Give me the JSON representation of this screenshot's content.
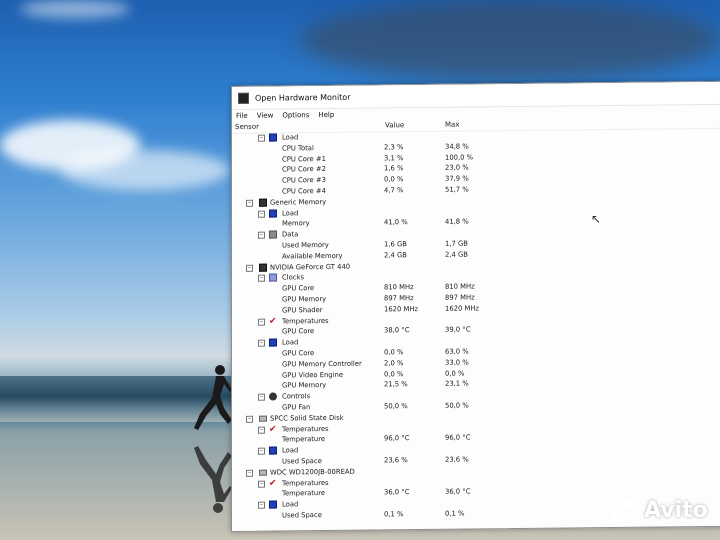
{
  "window": {
    "title": "Open Hardware Monitor",
    "menu": [
      "File",
      "View",
      "Options",
      "Help"
    ],
    "columns": {
      "sensor": "Sensor",
      "value": "Value",
      "max": "Max"
    }
  },
  "tree": [
    {
      "label": "Load",
      "value": "",
      "max": "",
      "indent": 1,
      "icon": "load-icon",
      "expander": "minus"
    },
    {
      "label": "CPU Total",
      "value": "2,3 %",
      "max": "34,8 %",
      "indent": 2,
      "icon": "",
      "expander": ""
    },
    {
      "label": "CPU Core #1",
      "value": "3,1 %",
      "max": "100,0 %",
      "indent": 2,
      "icon": "",
      "expander": ""
    },
    {
      "label": "CPU Core #2",
      "value": "1,6 %",
      "max": "23,0 %",
      "indent": 2,
      "icon": "",
      "expander": ""
    },
    {
      "label": "CPU Core #3",
      "value": "0,0 %",
      "max": "37,9 %",
      "indent": 2,
      "icon": "",
      "expander": ""
    },
    {
      "label": "CPU Core #4",
      "value": "4,7 %",
      "max": "51,7 %",
      "indent": 2,
      "icon": "",
      "expander": ""
    },
    {
      "label": "Generic Memory",
      "value": "",
      "max": "",
      "indent": 0,
      "icon": "memory-chip-icon",
      "expander": "minus"
    },
    {
      "label": "Load",
      "value": "",
      "max": "",
      "indent": 1,
      "icon": "load-icon",
      "expander": "minus"
    },
    {
      "label": "Memory",
      "value": "41,0 %",
      "max": "41,8 %",
      "indent": 2,
      "icon": "",
      "expander": ""
    },
    {
      "label": "Data",
      "value": "",
      "max": "",
      "indent": 1,
      "icon": "data-icon",
      "expander": "minus"
    },
    {
      "label": "Used Memory",
      "value": "1,6 GB",
      "max": "1,7 GB",
      "indent": 2,
      "icon": "",
      "expander": ""
    },
    {
      "label": "Available Memory",
      "value": "2,4 GB",
      "max": "2,4 GB",
      "indent": 2,
      "icon": "",
      "expander": ""
    },
    {
      "label": "NVIDIA GeForce GT 440",
      "value": "",
      "max": "",
      "indent": 0,
      "icon": "gpu-icon",
      "expander": "minus"
    },
    {
      "label": "Clocks",
      "value": "",
      "max": "",
      "indent": 1,
      "icon": "clock-icon",
      "expander": "minus"
    },
    {
      "label": "GPU Core",
      "value": "810 MHz",
      "max": "810 MHz",
      "indent": 2,
      "icon": "",
      "expander": ""
    },
    {
      "label": "GPU Memory",
      "value": "897 MHz",
      "max": "897 MHz",
      "indent": 2,
      "icon": "",
      "expander": ""
    },
    {
      "label": "GPU Shader",
      "value": "1620 MHz",
      "max": "1620 MHz",
      "indent": 2,
      "icon": "",
      "expander": ""
    },
    {
      "label": "Temperatures",
      "value": "",
      "max": "",
      "indent": 1,
      "icon": "thermometer-icon",
      "expander": "minus"
    },
    {
      "label": "GPU Core",
      "value": "38,0 °C",
      "max": "39,0 °C",
      "indent": 2,
      "icon": "",
      "expander": ""
    },
    {
      "label": "Load",
      "value": "",
      "max": "",
      "indent": 1,
      "icon": "load-icon",
      "expander": "minus"
    },
    {
      "label": "GPU Core",
      "value": "0,0 %",
      "max": "63,0 %",
      "indent": 2,
      "icon": "",
      "expander": ""
    },
    {
      "label": "GPU Memory Controller",
      "value": "2,0 %",
      "max": "33,0 %",
      "indent": 2,
      "icon": "",
      "expander": ""
    },
    {
      "label": "GPU Video Engine",
      "value": "0,0 %",
      "max": "0,0 %",
      "indent": 2,
      "icon": "",
      "expander": ""
    },
    {
      "label": "GPU Memory",
      "value": "21,5 %",
      "max": "23,1 %",
      "indent": 2,
      "icon": "",
      "expander": ""
    },
    {
      "label": "Controls",
      "value": "",
      "max": "",
      "indent": 1,
      "icon": "fan-icon",
      "expander": "minus"
    },
    {
      "label": "GPU Fan",
      "value": "50,0 %",
      "max": "50,0 %",
      "indent": 2,
      "icon": "",
      "expander": ""
    },
    {
      "label": "SPCC Solid State Disk",
      "value": "",
      "max": "",
      "indent": 0,
      "icon": "disk-icon",
      "expander": "minus"
    },
    {
      "label": "Temperatures",
      "value": "",
      "max": "",
      "indent": 1,
      "icon": "thermometer-icon",
      "expander": "minus"
    },
    {
      "label": "Temperature",
      "value": "96,0 °C",
      "max": "96,0 °C",
      "indent": 2,
      "icon": "",
      "expander": ""
    },
    {
      "label": "Load",
      "value": "",
      "max": "",
      "indent": 1,
      "icon": "load-icon",
      "expander": "minus"
    },
    {
      "label": "Used Space",
      "value": "23,6 %",
      "max": "23,6 %",
      "indent": 2,
      "icon": "",
      "expander": ""
    },
    {
      "label": "WDC WD1200JB-00READ",
      "value": "",
      "max": "",
      "indent": 0,
      "icon": "disk-icon",
      "expander": "minus"
    },
    {
      "label": "Temperatures",
      "value": "",
      "max": "",
      "indent": 1,
      "icon": "thermometer-icon",
      "expander": "minus"
    },
    {
      "label": "Temperature",
      "value": "36,0 °C",
      "max": "36,0 °C",
      "indent": 2,
      "icon": "",
      "expander": ""
    },
    {
      "label": "Load",
      "value": "",
      "max": "",
      "indent": 1,
      "icon": "load-icon",
      "expander": "minus"
    },
    {
      "label": "Used Space",
      "value": "0,1 %",
      "max": "0,1 %",
      "indent": 2,
      "icon": "",
      "expander": ""
    }
  ],
  "watermark": {
    "brand": "Avito"
  }
}
